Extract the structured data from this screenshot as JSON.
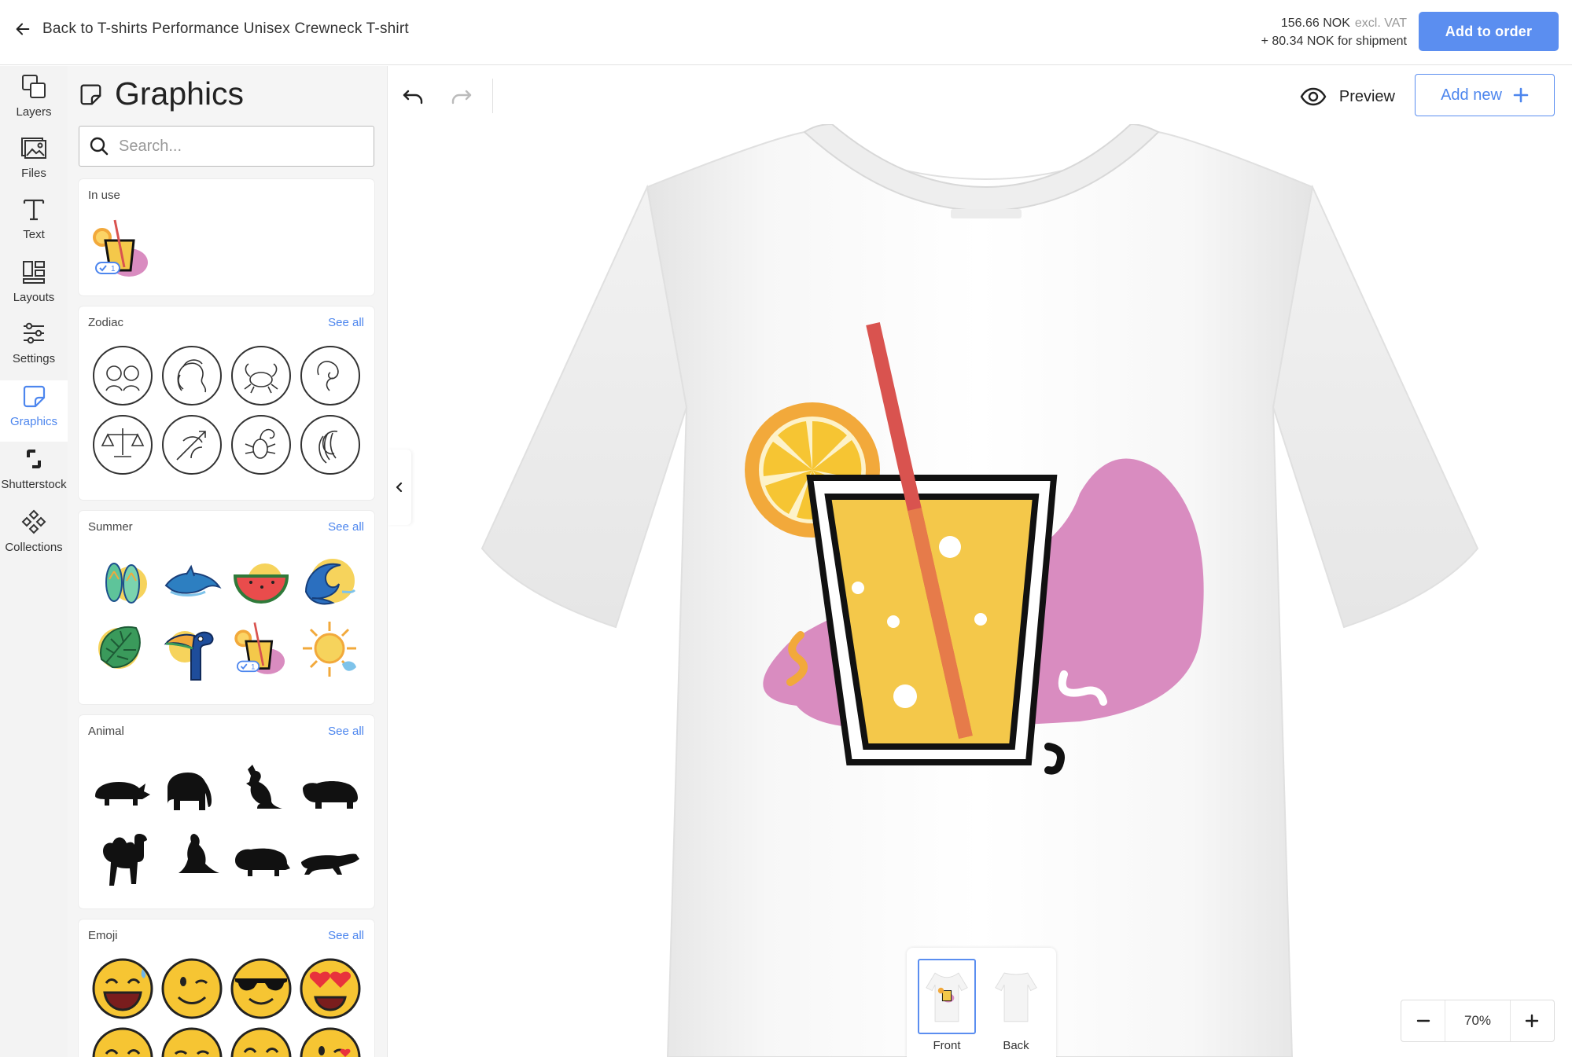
{
  "header": {
    "back_label": "Back to T-shirts Performance Unisex Crewneck T-shirt",
    "price": "156.66 NOK",
    "price_note": "excl. VAT",
    "shipping": "+ 80.34 NOK for shipment",
    "add_to_order": "Add to order"
  },
  "rail": {
    "items": [
      {
        "label": "Layers",
        "icon": "layers-icon"
      },
      {
        "label": "Files",
        "icon": "image-icon"
      },
      {
        "label": "Text",
        "icon": "text-icon"
      },
      {
        "label": "Layouts",
        "icon": "layouts-icon"
      },
      {
        "label": "Settings",
        "icon": "sliders-icon"
      },
      {
        "label": "Graphics",
        "icon": "sticker-icon",
        "active": true
      },
      {
        "label": "Shutterstock",
        "icon": "shutterstock-icon"
      },
      {
        "label": "Collections",
        "icon": "diamond-grid-icon"
      }
    ]
  },
  "panel": {
    "title": "Graphics",
    "search_placeholder": "Search...",
    "see_all": "See all",
    "sections": {
      "in_use": "In use",
      "zodiac": "Zodiac",
      "summer": "Summer",
      "animal": "Animal",
      "emoji": "Emoji"
    },
    "in_use_badge": "1",
    "summer_badge": "1"
  },
  "toolbar": {
    "preview": "Preview",
    "add_new": "Add new"
  },
  "views": {
    "front": "Front",
    "back": "Back",
    "active": "front"
  },
  "zoom": {
    "value": "70%"
  },
  "colors": {
    "accent": "#5b8ef0",
    "drink": "#f4c84a",
    "orange": "#f2a93b",
    "straw": "#d9534f",
    "blob": "#d98cc0"
  }
}
